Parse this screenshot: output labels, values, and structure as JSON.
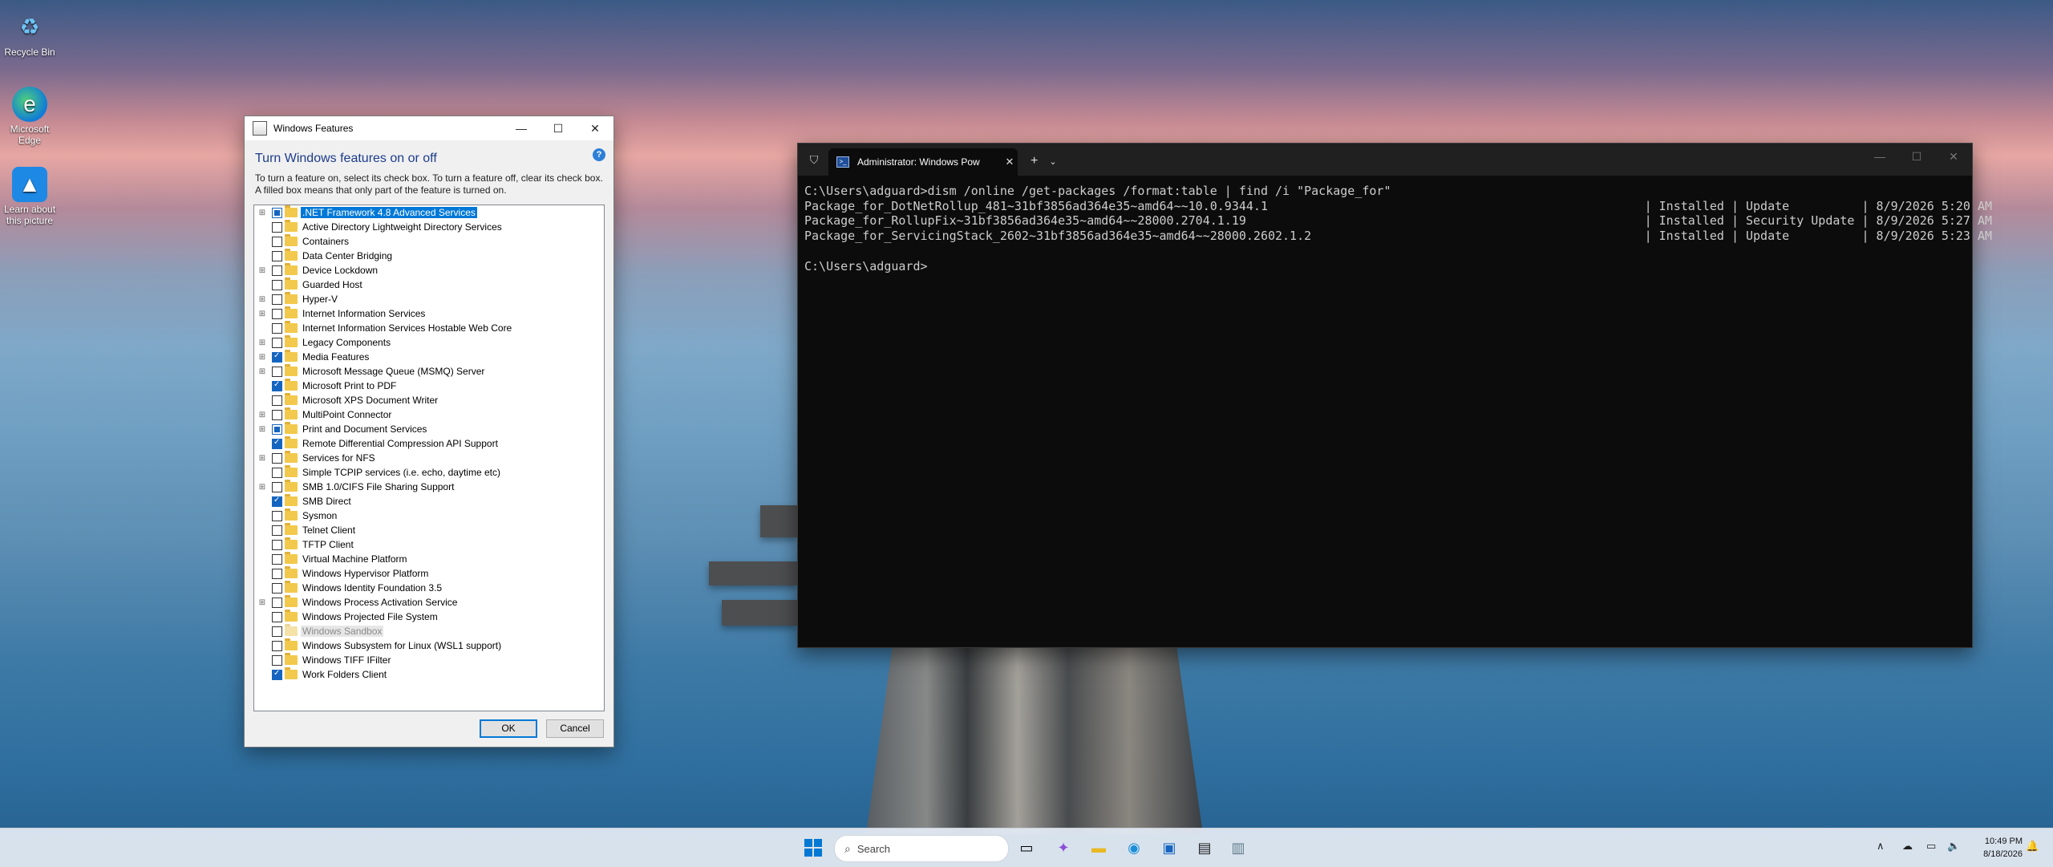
{
  "desktop": {
    "icons": [
      {
        "label": "Recycle Bin",
        "icon": "recycle-bin-icon"
      },
      {
        "label": "Microsoft Edge",
        "icon": "edge-icon"
      },
      {
        "label": "Learn about this picture",
        "icon": "spotlight-icon"
      }
    ]
  },
  "features_dialog": {
    "title": "Windows Features",
    "heading": "Turn Windows features on or off",
    "description": "To turn a feature on, select its check box. To turn a feature off, clear its check box. A filled box means that only part of the feature is turned on.",
    "ok_label": "OK",
    "cancel_label": "Cancel",
    "items": [
      {
        "label": ".NET Framework 4.8 Advanced Services",
        "expandable": true,
        "state": "partial",
        "selected": true
      },
      {
        "label": "Active Directory Lightweight Directory Services",
        "expandable": false,
        "state": "unchecked"
      },
      {
        "label": "Containers",
        "expandable": false,
        "state": "unchecked"
      },
      {
        "label": "Data Center Bridging",
        "expandable": false,
        "state": "unchecked"
      },
      {
        "label": "Device Lockdown",
        "expandable": true,
        "state": "unchecked"
      },
      {
        "label": "Guarded Host",
        "expandable": false,
        "state": "unchecked"
      },
      {
        "label": "Hyper-V",
        "expandable": true,
        "state": "unchecked"
      },
      {
        "label": "Internet Information Services",
        "expandable": true,
        "state": "unchecked"
      },
      {
        "label": "Internet Information Services Hostable Web Core",
        "expandable": false,
        "state": "unchecked"
      },
      {
        "label": "Legacy Components",
        "expandable": true,
        "state": "unchecked"
      },
      {
        "label": "Media Features",
        "expandable": true,
        "state": "checked"
      },
      {
        "label": "Microsoft Message Queue (MSMQ) Server",
        "expandable": true,
        "state": "unchecked"
      },
      {
        "label": "Microsoft Print to PDF",
        "expandable": false,
        "state": "checked"
      },
      {
        "label": "Microsoft XPS Document Writer",
        "expandable": false,
        "state": "unchecked"
      },
      {
        "label": "MultiPoint Connector",
        "expandable": true,
        "state": "unchecked"
      },
      {
        "label": "Print and Document Services",
        "expandable": true,
        "state": "partial"
      },
      {
        "label": "Remote Differential Compression API Support",
        "expandable": false,
        "state": "checked"
      },
      {
        "label": "Services for NFS",
        "expandable": true,
        "state": "unchecked"
      },
      {
        "label": "Simple TCPIP services (i.e. echo, daytime etc)",
        "expandable": false,
        "state": "unchecked"
      },
      {
        "label": "SMB 1.0/CIFS File Sharing Support",
        "expandable": true,
        "state": "unchecked"
      },
      {
        "label": "SMB Direct",
        "expandable": false,
        "state": "checked"
      },
      {
        "label": "Sysmon",
        "expandable": false,
        "state": "unchecked"
      },
      {
        "label": "Telnet Client",
        "expandable": false,
        "state": "unchecked"
      },
      {
        "label": "TFTP Client",
        "expandable": false,
        "state": "unchecked"
      },
      {
        "label": "Virtual Machine Platform",
        "expandable": false,
        "state": "unchecked"
      },
      {
        "label": "Windows Hypervisor Platform",
        "expandable": false,
        "state": "unchecked"
      },
      {
        "label": "Windows Identity Foundation 3.5",
        "expandable": false,
        "state": "unchecked"
      },
      {
        "label": "Windows Process Activation Service",
        "expandable": true,
        "state": "unchecked"
      },
      {
        "label": "Windows Projected File System",
        "expandable": false,
        "state": "unchecked"
      },
      {
        "label": "Windows Sandbox",
        "expandable": false,
        "state": "unchecked",
        "disabled": true
      },
      {
        "label": "Windows Subsystem for Linux (WSL1 support)",
        "expandable": false,
        "state": "unchecked"
      },
      {
        "label": "Windows TIFF IFilter",
        "expandable": false,
        "state": "unchecked"
      },
      {
        "label": "Work Folders Client",
        "expandable": false,
        "state": "checked"
      }
    ]
  },
  "terminal": {
    "tab_title": "Administrator: Windows Pow",
    "lines": [
      "C:\\Users\\adguard>dism /online /get-packages /format:table | find /i \"Package_for\"",
      "Package_for_DotNetRollup_481~31bf3856ad364e35~amd64~~10.0.9344.1                                                    | Installed | Update          | 8/9/2026 5:20 AM",
      "Package_for_RollupFix~31bf3856ad364e35~amd64~~28000.2704.1.19                                                       | Installed | Security Update | 8/9/2026 5:27 AM",
      "Package_for_ServicingStack_2602~31bf3856ad364e35~amd64~~28000.2602.1.2                                              | Installed | Update          | 8/9/2026 5:23 AM",
      "",
      "C:\\Users\\adguard>"
    ]
  },
  "taskbar": {
    "search_placeholder": "Search",
    "time": "10:49 PM",
    "date": "8/18/2026"
  }
}
